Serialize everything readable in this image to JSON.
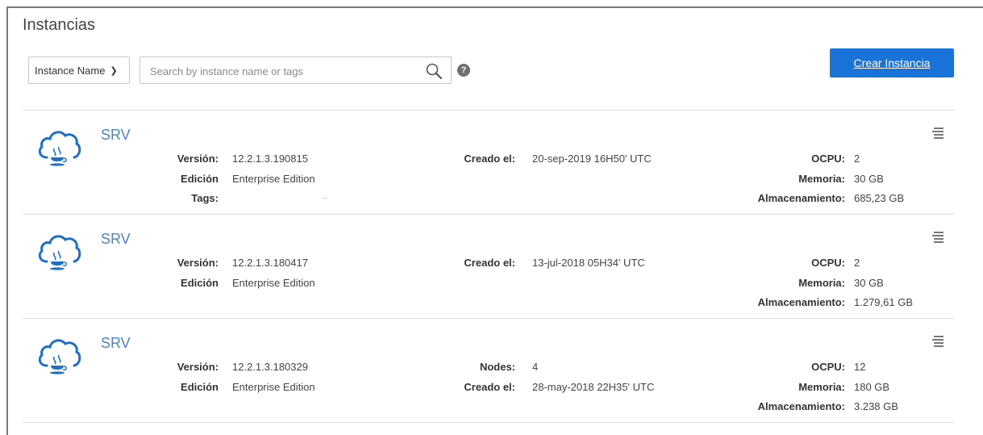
{
  "page": {
    "title": "Instancias"
  },
  "toolbar": {
    "filter_select": "Instance Name",
    "search_placeholder": "Search by instance name or tags",
    "help": "?",
    "create_label": "Crear Instancia"
  },
  "labels": {
    "version": "Versión:",
    "edition": "Edición",
    "tags": "Tags:",
    "created": "Creado el:",
    "nodes": "Nodes:",
    "ocpu": "OCPU:",
    "memory": "Memoria:",
    "storage": "Almacenamiento:"
  },
  "instances": [
    {
      "name": "SRV",
      "version": "12.2.1.3.190815",
      "edition": "Enterprise Edition",
      "tags": "...",
      "created": "20-sep-2019 16H50' UTC",
      "ocpu": "2",
      "memory": "30 GB",
      "storage": "685,23 GB"
    },
    {
      "name": "SRV",
      "version": "12.2.1.3.180417",
      "edition": "Enterprise Edition",
      "created": "13-jul-2018 05H34' UTC",
      "ocpu": "2",
      "memory": "30 GB",
      "storage": "1.279,61 GB"
    },
    {
      "name": "SRV",
      "version": "12.2.1.3.180329",
      "edition": "Enterprise Edition",
      "nodes": "4",
      "created": "28-may-2018 22H35' UTC",
      "ocpu": "12",
      "memory": "180 GB",
      "storage": "3.238 GB"
    }
  ],
  "icons": {
    "instance": "cloud-java-icon",
    "menu": "hamburger-menu-icon",
    "search": "magnifier-icon",
    "help": "question-circle-icon",
    "dropdown": "chevron-down-icon"
  },
  "colors": {
    "accent": "#1a73d9",
    "link": "#4a86c5"
  }
}
